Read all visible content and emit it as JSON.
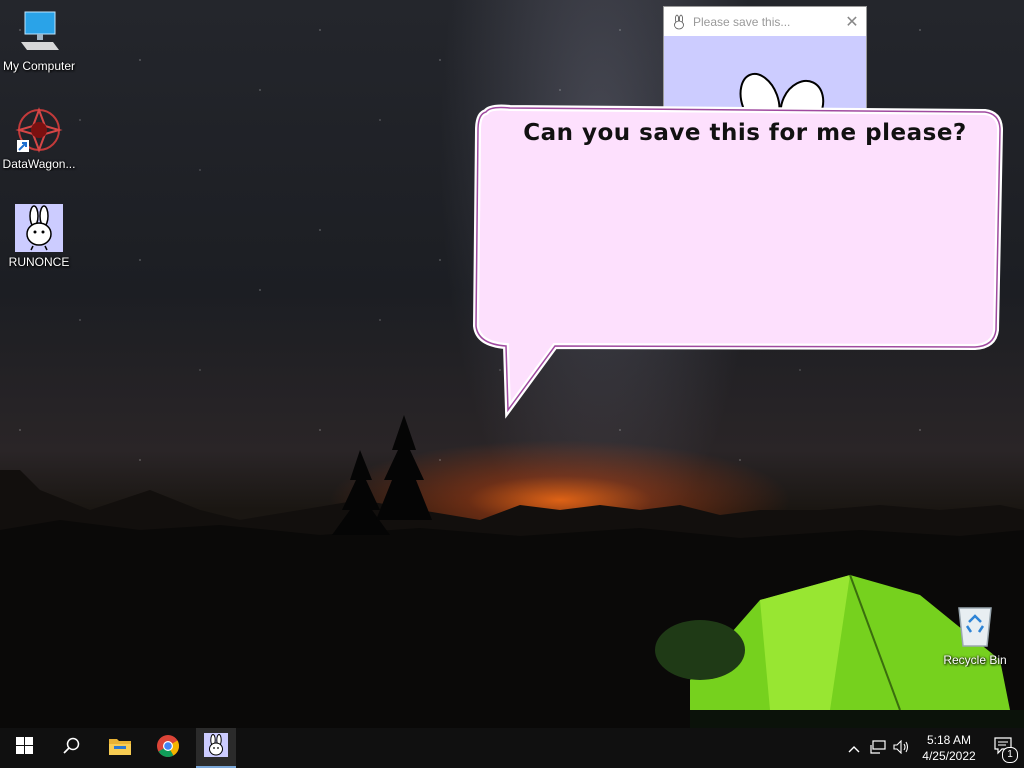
{
  "desktop": {
    "icons": [
      {
        "label": "My Computer",
        "icon": "computer-icon"
      },
      {
        "label": "DataWagon...",
        "icon": "datawagon-shortcut-icon"
      },
      {
        "label": "RUNONCE",
        "icon": "bunny-app-icon"
      },
      {
        "label": "Recycle Bin",
        "icon": "recycle-bin-icon"
      }
    ]
  },
  "app_window": {
    "title": "Please save this...",
    "client_color": "#ccccff"
  },
  "speech_bubble": {
    "text": "Can you save this for me please?",
    "fill_color": "#fde0fd",
    "outline_color": "#a04aa0"
  },
  "taskbar": {
    "buttons": [
      {
        "name": "start",
        "icon": "windows-start-icon"
      },
      {
        "name": "search",
        "icon": "search-icon"
      },
      {
        "name": "file-explorer",
        "icon": "folder-icon"
      },
      {
        "name": "chrome",
        "icon": "chrome-icon"
      },
      {
        "name": "runonce",
        "icon": "bunny-app-icon",
        "active": true
      }
    ],
    "tray": {
      "icons": [
        "chevron-up-icon",
        "network-icon",
        "volume-icon"
      ],
      "time": "5:18 AM",
      "date": "4/25/2022",
      "notification_count": "1"
    }
  }
}
